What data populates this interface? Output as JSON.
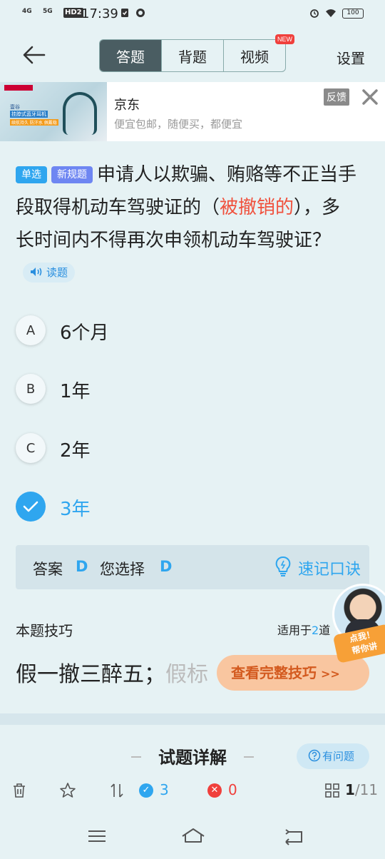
{
  "status_bar": {
    "network1": "4G",
    "network2": "5G",
    "hd": "HD2",
    "time": "17:39",
    "battery": "100"
  },
  "nav": {
    "tabs": [
      "答题",
      "背题",
      "视频"
    ],
    "active_tab": "答题",
    "new_badge": "NEW",
    "settings": "设置"
  },
  "ad": {
    "image_lines": [
      "壹谷",
      "挂脖式蓝牙耳机",
      "续航持久 防汗水 佩戴稳"
    ],
    "title": "京东",
    "subtitle": "便宜包邮，随便买，都便宜",
    "feedback": "反馈"
  },
  "question": {
    "tag_type": "单选",
    "tag_new": "新规题",
    "text_before": "申请人以欺骗、贿赂等不正当手段取得机动车驾驶证的（",
    "text_highlight": "被撤销的",
    "text_after": "），多长时间内不得再次申领机动车驾驶证？",
    "read_button": "读题"
  },
  "options": [
    {
      "letter": "A",
      "text": "6个月",
      "selected": false
    },
    {
      "letter": "B",
      "text": "1年",
      "selected": false
    },
    {
      "letter": "C",
      "text": "2年",
      "selected": false
    },
    {
      "letter": "D",
      "text": "3年",
      "selected": true
    }
  ],
  "answer": {
    "answer_label": "答案",
    "answer_value": "D",
    "chosen_label": "您选择",
    "chosen_value": "D",
    "memo": "速记口诀"
  },
  "tip": {
    "title": "本题技巧",
    "applies_prefix": "适用于",
    "applies_num": "2",
    "applies_suffix": "道",
    "text": "假一撤三醉五；",
    "text_fade": "假标",
    "button": "查看完整技巧",
    "button_arrow": ">>"
  },
  "avatar": {
    "bubble": "点我！\n帮你讲"
  },
  "detail": {
    "title": "试题详解",
    "ask_button": "有问题"
  },
  "toolbar": {
    "correct_count": "3",
    "wrong_count": "0",
    "page_current": "1",
    "page_total": "/11"
  },
  "colors": {
    "accent": "#2fa6ef",
    "highlight": "#f0503c",
    "tip_button": "#f9c6a0",
    "active_tab": "#4a5d62"
  }
}
